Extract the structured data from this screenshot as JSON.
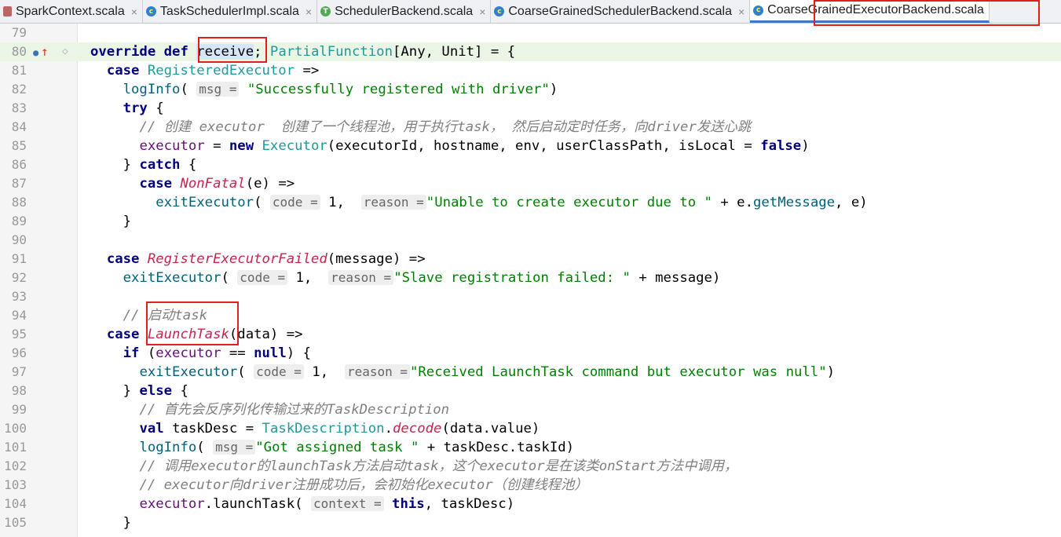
{
  "tabs": [
    {
      "label": "SparkContext.scala",
      "icon": "scala-file-icon",
      "active": false
    },
    {
      "label": "TaskSchedulerImpl.scala",
      "icon": "class-icon",
      "active": false
    },
    {
      "label": "SchedulerBackend.scala",
      "icon": "trait-icon",
      "active": false
    },
    {
      "label": "CoarseGrainedSchedulerBackend.scala",
      "icon": "class-icon",
      "active": false
    },
    {
      "label": "CoarseGrainedExecutorBackend.scala",
      "icon": "class-icon",
      "active": true
    }
  ],
  "close_glyph": "×",
  "lines": [
    {
      "n": "79",
      "tokens": []
    },
    {
      "n": "80",
      "tokens": [
        [
          "kw",
          "override def "
        ],
        [
          "recv",
          "receive"
        ],
        [
          "",
          "; "
        ],
        [
          "ty",
          "PartialFunction"
        ],
        [
          "",
          "[Any, Unit] = {"
        ]
      ]
    },
    {
      "n": "81",
      "tokens": [
        [
          "",
          "  "
        ],
        [
          "kw",
          "case "
        ],
        [
          "ty",
          "RegisteredExecutor"
        ],
        [
          "",
          " =>"
        ]
      ]
    },
    {
      "n": "82",
      "tokens": [
        [
          "",
          "    "
        ],
        [
          "fn",
          "logInfo"
        ],
        [
          "",
          "( "
        ],
        [
          "hint",
          "msg ="
        ],
        [
          "str",
          " \"Successfully registered with driver\""
        ],
        [
          "",
          ")"
        ]
      ]
    },
    {
      "n": "83",
      "tokens": [
        [
          "",
          "    "
        ],
        [
          "kw",
          "try"
        ],
        [
          "",
          " {"
        ]
      ]
    },
    {
      "n": "84",
      "tokens": [
        [
          "",
          "      "
        ],
        [
          "cm",
          "// 创建 executor  创建了一个线程池，用于执行task， 然后启动定时任务，向driver发送心跳"
        ]
      ]
    },
    {
      "n": "85",
      "tokens": [
        [
          "",
          "      "
        ],
        [
          "par",
          "executor"
        ],
        [
          "",
          " = "
        ],
        [
          "kw",
          "new "
        ],
        [
          "ty",
          "Executor"
        ],
        [
          "",
          "(executorId, hostname, env, userClassPath, isLocal = "
        ],
        [
          "kw",
          "false"
        ],
        [
          "",
          ")"
        ]
      ]
    },
    {
      "n": "86",
      "tokens": [
        [
          "",
          "    } "
        ],
        [
          "kw",
          "catch"
        ],
        [
          "",
          " {"
        ]
      ]
    },
    {
      "n": "87",
      "tokens": [
        [
          "",
          "      "
        ],
        [
          "kw",
          "case "
        ],
        [
          "it",
          "NonFatal"
        ],
        [
          "",
          "(e) =>"
        ]
      ]
    },
    {
      "n": "88",
      "tokens": [
        [
          "",
          "        "
        ],
        [
          "fn",
          "exitExecutor"
        ],
        [
          "",
          "( "
        ],
        [
          "hint",
          "code ="
        ],
        [
          "",
          " 1,  "
        ],
        [
          "hint",
          "reason ="
        ],
        [
          "str",
          "\"Unable to create executor due to \""
        ],
        [
          "",
          " + e."
        ],
        [
          "fn",
          "getMessage"
        ],
        [
          "",
          ", e)"
        ]
      ]
    },
    {
      "n": "89",
      "tokens": [
        [
          "",
          "    }"
        ]
      ]
    },
    {
      "n": "90",
      "tokens": []
    },
    {
      "n": "91",
      "tokens": [
        [
          "",
          "  "
        ],
        [
          "kw",
          "case "
        ],
        [
          "it",
          "RegisterExecutorFailed"
        ],
        [
          "",
          "(message) =>"
        ]
      ]
    },
    {
      "n": "92",
      "tokens": [
        [
          "",
          "    "
        ],
        [
          "fn",
          "exitExecutor"
        ],
        [
          "",
          "( "
        ],
        [
          "hint",
          "code ="
        ],
        [
          "",
          " 1,  "
        ],
        [
          "hint",
          "reason ="
        ],
        [
          "str",
          "\"Slave registration failed: \""
        ],
        [
          "",
          " + message)"
        ]
      ]
    },
    {
      "n": "93",
      "tokens": []
    },
    {
      "n": "94",
      "tokens": [
        [
          "",
          "    "
        ],
        [
          "cm",
          "// 启动task"
        ]
      ]
    },
    {
      "n": "95",
      "tokens": [
        [
          "",
          "  "
        ],
        [
          "kw",
          "case "
        ],
        [
          "it",
          "LaunchTask"
        ],
        [
          "",
          "(data) =>"
        ]
      ]
    },
    {
      "n": "96",
      "tokens": [
        [
          "",
          "    "
        ],
        [
          "kw",
          "if"
        ],
        [
          "",
          " ("
        ],
        [
          "par",
          "executor"
        ],
        [
          "",
          " == "
        ],
        [
          "kw",
          "null"
        ],
        [
          "",
          ") {"
        ]
      ]
    },
    {
      "n": "97",
      "tokens": [
        [
          "",
          "      "
        ],
        [
          "fn",
          "exitExecutor"
        ],
        [
          "",
          "( "
        ],
        [
          "hint",
          "code ="
        ],
        [
          "",
          " 1,  "
        ],
        [
          "hint",
          "reason ="
        ],
        [
          "str",
          "\"Received LaunchTask command but executor was null\""
        ],
        [
          "",
          ")"
        ]
      ]
    },
    {
      "n": "98",
      "tokens": [
        [
          "",
          "    } "
        ],
        [
          "kw",
          "else"
        ],
        [
          "",
          " {"
        ]
      ]
    },
    {
      "n": "99",
      "tokens": [
        [
          "",
          "      "
        ],
        [
          "cm",
          "// 首先会反序列化传输过来的TaskDescription"
        ]
      ]
    },
    {
      "n": "100",
      "tokens": [
        [
          "",
          "      "
        ],
        [
          "kw",
          "val "
        ],
        [
          "",
          "taskDesc = "
        ],
        [
          "ty",
          "TaskDescription"
        ],
        [
          "",
          "."
        ],
        [
          "it",
          "decode"
        ],
        [
          "",
          "(data.value)"
        ]
      ]
    },
    {
      "n": "101",
      "tokens": [
        [
          "",
          "      "
        ],
        [
          "fn",
          "logInfo"
        ],
        [
          "",
          "( "
        ],
        [
          "hint",
          "msg ="
        ],
        [
          "str",
          "\"Got assigned task \""
        ],
        [
          "",
          " + taskDesc.taskId)"
        ]
      ]
    },
    {
      "n": "102",
      "tokens": [
        [
          "",
          "      "
        ],
        [
          "cm",
          "// 调用executor的launchTask方法启动task，这个executor是在该类onStart方法中调用，"
        ]
      ]
    },
    {
      "n": "103",
      "tokens": [
        [
          "",
          "      "
        ],
        [
          "cm",
          "// executor向driver注册成功后，会初始化executor（创建线程池）"
        ]
      ]
    },
    {
      "n": "104",
      "tokens": [
        [
          "",
          "      "
        ],
        [
          "par",
          "executor"
        ],
        [
          "",
          ".launchTask( "
        ],
        [
          "hint",
          "context ="
        ],
        [
          "",
          " "
        ],
        [
          "kw",
          "this"
        ],
        [
          "",
          ", taskDesc)"
        ]
      ]
    },
    {
      "n": "105",
      "tokens": [
        [
          "",
          "    }"
        ]
      ]
    }
  ],
  "gutter_icons": {
    "override": "override-icon",
    "up_arrow": "up-arrow-icon"
  }
}
